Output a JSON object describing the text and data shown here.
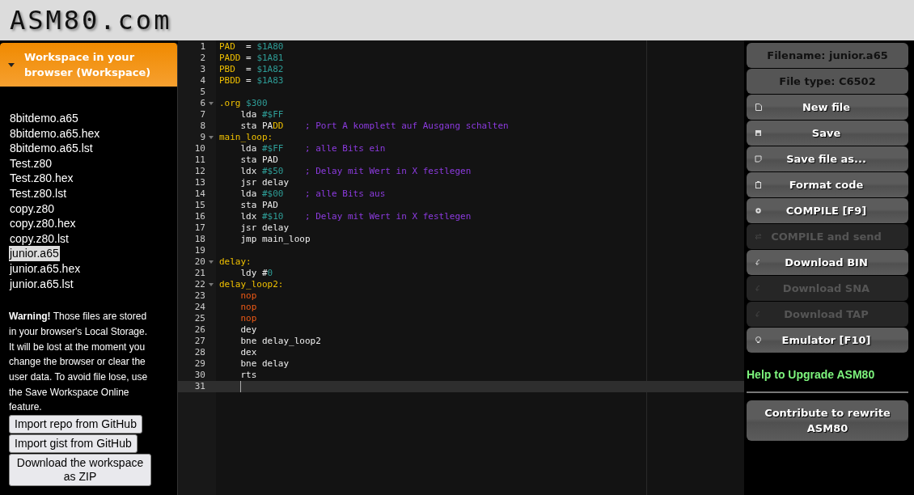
{
  "logo": {
    "text": "ASM80.com"
  },
  "workspace": {
    "title": "Workspace in your browser (Workspace)",
    "expanded": true,
    "files": [
      {
        "name": "8bitdemo.a65",
        "selected": false
      },
      {
        "name": "8bitdemo.a65.hex",
        "selected": false
      },
      {
        "name": "8bitdemo.a65.lst",
        "selected": false
      },
      {
        "name": "Test.z80",
        "selected": false
      },
      {
        "name": "Test.z80.hex",
        "selected": false
      },
      {
        "name": "Test.z80.lst",
        "selected": false
      },
      {
        "name": "copy.z80",
        "selected": false
      },
      {
        "name": "copy.z80.hex",
        "selected": false
      },
      {
        "name": "copy.z80.lst",
        "selected": false
      },
      {
        "name": "junior.a65",
        "selected": true
      },
      {
        "name": "junior.a65.hex",
        "selected": false
      },
      {
        "name": "junior.a65.lst",
        "selected": false
      }
    ],
    "warning": "**Warning!** Those files are stored in your browser's Local Storage. It will be lost at the moment you change the browser or clear the user data. To avoid file lose, use the Save Workspace Online feature.",
    "buttons": [
      "Import repo from GitHub",
      "Import gist from GitHub",
      "Download the workspace as ZIP"
    ]
  },
  "editor": {
    "lines": [
      {
        "number": "1",
        "foldable": false,
        "current": false,
        "indented": false,
        "tokens": [
          {
            "kind": "label",
            "text": "PAD"
          },
          {
            "kind": "text",
            "text": "  = "
          },
          {
            "kind": "num",
            "text": "$1A80"
          }
        ]
      },
      {
        "number": "2",
        "foldable": false,
        "current": false,
        "indented": false,
        "tokens": [
          {
            "kind": "label",
            "text": "PADD"
          },
          {
            "kind": "text",
            "text": " = "
          },
          {
            "kind": "num",
            "text": "$1A81"
          }
        ]
      },
      {
        "number": "3",
        "foldable": false,
        "current": false,
        "indented": false,
        "tokens": [
          {
            "kind": "label",
            "text": "PBD"
          },
          {
            "kind": "text",
            "text": "  = "
          },
          {
            "kind": "num",
            "text": "$1A82"
          }
        ]
      },
      {
        "number": "4",
        "foldable": false,
        "current": false,
        "indented": false,
        "tokens": [
          {
            "kind": "label",
            "text": "PBDD"
          },
          {
            "kind": "text",
            "text": " = "
          },
          {
            "kind": "num",
            "text": "$1A83"
          }
        ]
      },
      {
        "number": "5",
        "foldable": false,
        "current": false
      },
      {
        "number": "6",
        "foldable": true,
        "current": false,
        "indented": false,
        "tokens": [
          {
            "kind": "label",
            "text": ".org"
          },
          {
            "kind": "num",
            "text": " $300"
          }
        ]
      },
      {
        "number": "7",
        "foldable": false,
        "current": false,
        "indented": true,
        "tokens": [
          {
            "kind": "text",
            "text": "lda "
          },
          {
            "kind": "num",
            "text": "#$FF"
          }
        ]
      },
      {
        "number": "8",
        "foldable": false,
        "current": false,
        "indented": true,
        "tokens": [
          {
            "kind": "text",
            "text": "sta PA"
          },
          {
            "kind": "label",
            "text": "DD"
          },
          {
            "kind": "comment",
            "text": "    ; Port A komplett auf Ausgang schalten"
          }
        ]
      },
      {
        "number": "9",
        "foldable": true,
        "current": false,
        "indented": false,
        "tokens": [
          {
            "kind": "label",
            "text": "main_loop:"
          }
        ]
      },
      {
        "number": "10",
        "foldable": false,
        "current": false,
        "indented": true,
        "tokens": [
          {
            "kind": "text",
            "text": "lda "
          },
          {
            "kind": "num",
            "text": "#$FF"
          },
          {
            "kind": "comment",
            "text": "    ; alle Bits ein"
          }
        ]
      },
      {
        "number": "11",
        "foldable": false,
        "current": false,
        "indented": true,
        "tokens": [
          {
            "kind": "text",
            "text": "sta PAD"
          }
        ]
      },
      {
        "number": "12",
        "foldable": false,
        "current": false,
        "indented": true,
        "tokens": [
          {
            "kind": "text",
            "text": "ldx "
          },
          {
            "kind": "num",
            "text": "#$50"
          },
          {
            "kind": "comment",
            "text": "    ; Delay mit Wert in X festlegen"
          }
        ]
      },
      {
        "number": "13",
        "foldable": false,
        "current": false,
        "indented": true,
        "tokens": [
          {
            "kind": "text",
            "text": "jsr delay"
          }
        ]
      },
      {
        "number": "14",
        "foldable": false,
        "current": false,
        "indented": true,
        "tokens": [
          {
            "kind": "text",
            "text": "lda "
          },
          {
            "kind": "num",
            "text": "#$00"
          },
          {
            "kind": "comment",
            "text": "    ; alle Bits aus"
          }
        ]
      },
      {
        "number": "15",
        "foldable": false,
        "current": false,
        "indented": true,
        "tokens": [
          {
            "kind": "text",
            "text": "sta PAD"
          }
        ]
      },
      {
        "number": "16",
        "foldable": false,
        "current": false,
        "indented": true,
        "tokens": [
          {
            "kind": "text",
            "text": "ldx "
          },
          {
            "kind": "num",
            "text": "#$10"
          },
          {
            "kind": "comment",
            "text": "    ; Delay mit Wert in X festlegen"
          }
        ]
      },
      {
        "number": "17",
        "foldable": false,
        "current": false,
        "indented": true,
        "tokens": [
          {
            "kind": "text",
            "text": "jsr delay"
          }
        ]
      },
      {
        "number": "18",
        "foldable": false,
        "current": false,
        "indented": true,
        "tokens": [
          {
            "kind": "text",
            "text": "jmp main_loop"
          }
        ]
      },
      {
        "number": "19",
        "foldable": false,
        "current": false
      },
      {
        "number": "20",
        "foldable": true,
        "current": false,
        "indented": false,
        "tokens": [
          {
            "kind": "label",
            "text": "delay:"
          }
        ]
      },
      {
        "number": "21",
        "foldable": false,
        "current": false,
        "indented": true,
        "tokens": [
          {
            "kind": "text",
            "text": "ldy #"
          },
          {
            "kind": "num",
            "text": "0"
          }
        ]
      },
      {
        "number": "22",
        "foldable": true,
        "current": false,
        "indented": false,
        "tokens": [
          {
            "kind": "label",
            "text": "delay_loop2:"
          }
        ]
      },
      {
        "number": "23",
        "foldable": false,
        "current": false,
        "indented": true,
        "tokens": [
          {
            "kind": "keyword",
            "text": "nop"
          }
        ]
      },
      {
        "number": "24",
        "foldable": false,
        "current": false,
        "indented": true,
        "tokens": [
          {
            "kind": "keyword",
            "text": "nop"
          }
        ]
      },
      {
        "number": "25",
        "foldable": false,
        "current": false,
        "indented": true,
        "tokens": [
          {
            "kind": "keyword",
            "text": "nop"
          }
        ]
      },
      {
        "number": "26",
        "foldable": false,
        "current": false,
        "indented": true,
        "tokens": [
          {
            "kind": "text",
            "text": "dey"
          }
        ]
      },
      {
        "number": "27",
        "foldable": false,
        "current": false,
        "indented": true,
        "tokens": [
          {
            "kind": "text",
            "text": "bne delay_loop2"
          }
        ]
      },
      {
        "number": "28",
        "foldable": false,
        "current": false,
        "indented": true,
        "tokens": [
          {
            "kind": "text",
            "text": "dex"
          }
        ]
      },
      {
        "number": "29",
        "foldable": false,
        "current": false,
        "indented": true,
        "tokens": [
          {
            "kind": "text",
            "text": "bne delay"
          }
        ]
      },
      {
        "number": "30",
        "foldable": false,
        "current": false,
        "indented": true,
        "tokens": [
          {
            "kind": "text",
            "text": "rts"
          }
        ]
      },
      {
        "number": "31",
        "foldable": false,
        "current": true,
        "indented": true
      }
    ]
  },
  "toolbar": {
    "items": [
      {
        "kind": "info",
        "label": "Filename: junior.a65"
      },
      {
        "kind": "info",
        "label": "File type: C6502"
      },
      {
        "kind": "action",
        "label": "New file",
        "disabled": false
      },
      {
        "kind": "action",
        "label": "Save",
        "disabled": false
      },
      {
        "kind": "action",
        "label": "Save file as...",
        "disabled": false
      },
      {
        "kind": "action",
        "label": "Format code",
        "disabled": false
      },
      {
        "kind": "action",
        "label": "COMPILE [F9]",
        "disabled": false
      },
      {
        "kind": "action",
        "label": "COMPILE and send",
        "disabled": true
      },
      {
        "kind": "action",
        "label": "Download BIN",
        "disabled": false
      },
      {
        "kind": "action",
        "label": "Download SNA",
        "disabled": true
      },
      {
        "kind": "action",
        "label": "Download TAP",
        "disabled": true
      },
      {
        "kind": "action",
        "label": "Emulator [F10]",
        "disabled": false
      }
    ],
    "help_link": "Help to Upgrade ASM80",
    "contribute_button": "Contribute to rewrite ASM80"
  }
}
